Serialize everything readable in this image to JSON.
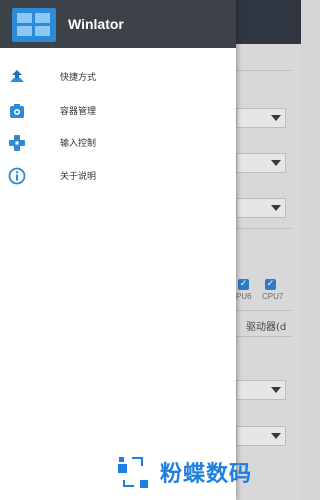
{
  "app": {
    "title": "Winlator"
  },
  "menu": [
    {
      "label": "快捷方式",
      "icon": "shortcut-icon"
    },
    {
      "label": "容器管理",
      "icon": "container-icon"
    },
    {
      "label": "输入控制",
      "icon": "gamepad-icon"
    },
    {
      "label": "关于说明",
      "icon": "info-icon"
    }
  ],
  "background": {
    "cpu_labels": [
      "PU6",
      "CPU7"
    ],
    "driver_label": "驱动器(d"
  },
  "watermark": {
    "text": "粉蝶数码"
  },
  "colors": {
    "header": "#3c4248",
    "accent": "#2c8ad8",
    "watermark": "#1f7fe0"
  }
}
